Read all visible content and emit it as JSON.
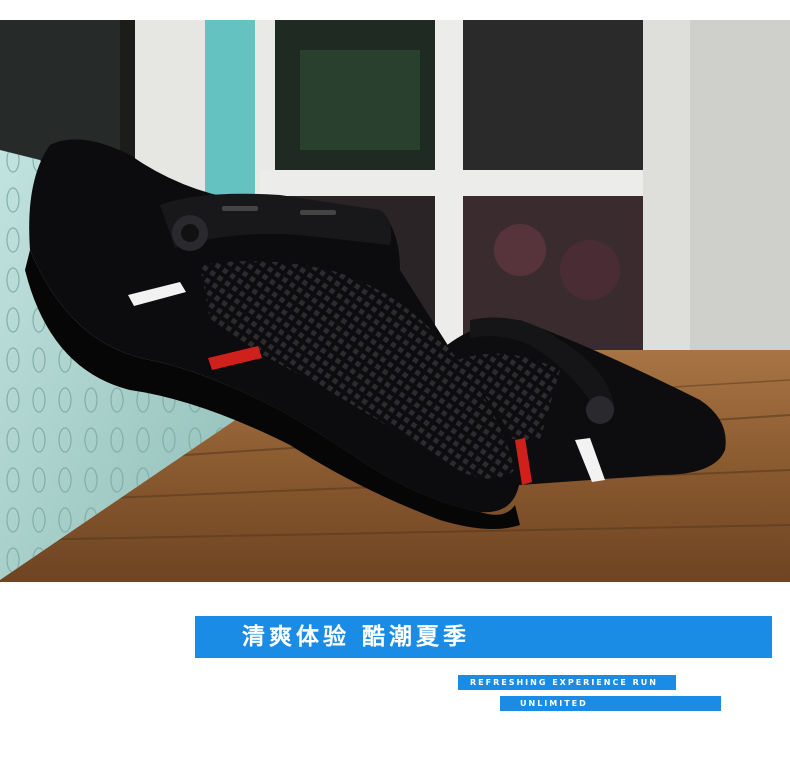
{
  "photo": {
    "subject": "black mesh clog sandals on wooden floor",
    "colors": {
      "shoe": "#0e0e10",
      "stripe_red": "#d0201c",
      "stripe_white": "#f2f2f2",
      "floor": "#8a5a32",
      "wall": "#a9d4cf"
    }
  },
  "banner": {
    "title": "清爽体验 酷潮夏季",
    "line1": "REFRESHING EXPERIENCE RUN",
    "line2": "UNLIMITED",
    "accent": "#1a8ce6"
  }
}
